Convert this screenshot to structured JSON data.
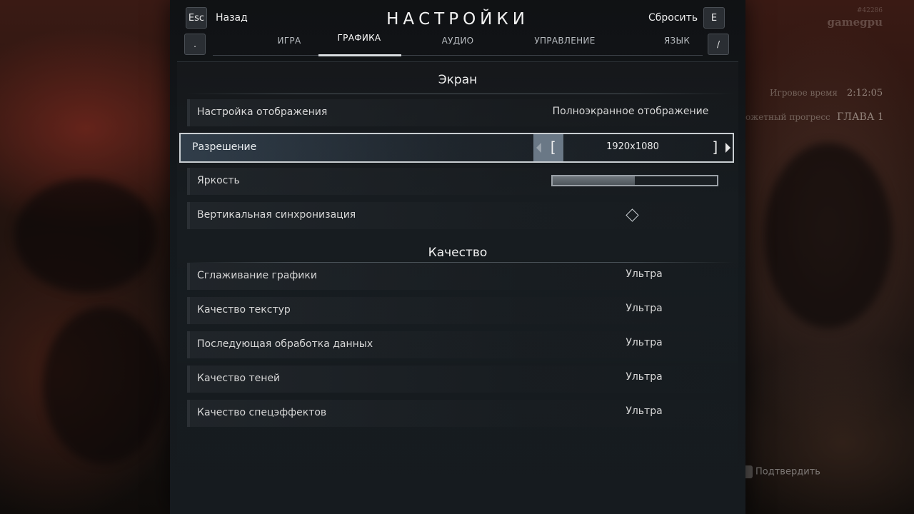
{
  "header": {
    "title": "НАСТРОЙКИ",
    "back_key": "Esc",
    "back_label": "Назад",
    "reset_label": "Сбросить",
    "reset_key": "E",
    "prev_tab_key": ".",
    "next_tab_key": "/"
  },
  "tabs": [
    {
      "label": "ИГРА",
      "active": false
    },
    {
      "label": "ГРАФИКА",
      "active": true
    },
    {
      "label": "АУДИО",
      "active": false
    },
    {
      "label": "УПРАВЛЕНИЕ",
      "active": false
    },
    {
      "label": "ЯЗЫК",
      "active": false
    }
  ],
  "sections": {
    "screen": {
      "title": "Экран",
      "display_mode": {
        "label": "Настройка отображения",
        "value": "Полноэкранное отображение"
      },
      "resolution": {
        "label": "Разрешение",
        "value": "1920x1080",
        "bracket_left": "[",
        "bracket_right": "]"
      },
      "brightness": {
        "label": "Яркость",
        "level": 0.5
      },
      "vsync": {
        "label": "Вертикальная синхронизация",
        "checked": false
      }
    },
    "quality": {
      "title": "Качество",
      "rows": [
        {
          "label": "Сглаживание графики",
          "value": "Ультра"
        },
        {
          "label": "Качество текстур",
          "value": "Ультра"
        },
        {
          "label": "Последующая обработка данных",
          "value": "Ультра"
        },
        {
          "label": "Качество теней",
          "value": "Ультра"
        },
        {
          "label": "Качество спецэффектов",
          "value": "Ультра"
        }
      ]
    }
  },
  "background": {
    "play_time_label": "Игровое время",
    "play_time_value": "2:12:05",
    "progress_label": "ожетный прогресс",
    "progress_value": "ГЛАВА 1",
    "watermark_num": "#42286",
    "watermark_name": "gamegpu",
    "confirm_label": "Подтвердить"
  },
  "colors": {
    "panel": "#14191d",
    "selected_border": "#c9ced2",
    "accent_cap": "#6a7886"
  }
}
